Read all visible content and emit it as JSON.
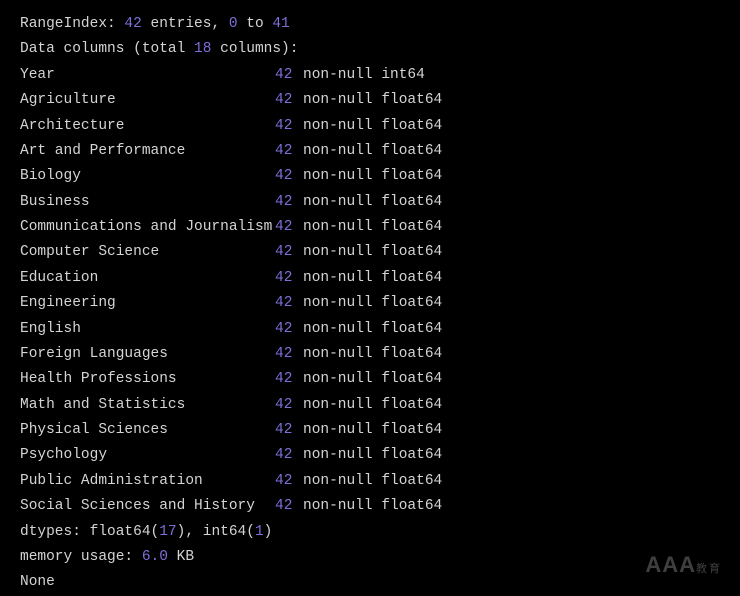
{
  "header": {
    "range_prefix": "RangeIndex: ",
    "entries_count": "42",
    "entries_text": " entries, ",
    "range_start": "0",
    "range_mid": " to ",
    "range_end": "41",
    "cols_prefix": "Data columns (total ",
    "cols_count": "18",
    "cols_suffix": " columns):"
  },
  "columns": [
    {
      "name": "Year",
      "count": "42",
      "suffix": "non-null int64"
    },
    {
      "name": "Agriculture",
      "count": "42",
      "suffix": "non-null float64"
    },
    {
      "name": "Architecture",
      "count": "42",
      "suffix": "non-null float64"
    },
    {
      "name": "Art and Performance",
      "count": "42",
      "suffix": "non-null float64"
    },
    {
      "name": "Biology",
      "count": "42",
      "suffix": "non-null float64"
    },
    {
      "name": "Business",
      "count": "42",
      "suffix": "non-null float64"
    },
    {
      "name": "Communications and Journalism",
      "count": "42",
      "suffix": "non-null float64"
    },
    {
      "name": "Computer Science",
      "count": "42",
      "suffix": "non-null float64"
    },
    {
      "name": "Education",
      "count": "42",
      "suffix": "non-null float64"
    },
    {
      "name": "Engineering",
      "count": "42",
      "suffix": "non-null float64"
    },
    {
      "name": "English",
      "count": "42",
      "suffix": "non-null float64"
    },
    {
      "name": "Foreign Languages",
      "count": "42",
      "suffix": "non-null float64"
    },
    {
      "name": "Health Professions",
      "count": "42",
      "suffix": "non-null float64"
    },
    {
      "name": "Math and Statistics",
      "count": "42",
      "suffix": "non-null float64"
    },
    {
      "name": "Physical Sciences",
      "count": "42",
      "suffix": "non-null float64"
    },
    {
      "name": "Psychology",
      "count": "42",
      "suffix": "non-null float64"
    },
    {
      "name": "Public Administration",
      "count": "42",
      "suffix": "non-null float64"
    },
    {
      "name": "Social Sciences and History",
      "count": "42",
      "suffix": "non-null float64"
    }
  ],
  "footer": {
    "dtypes_prefix": "dtypes: float64(",
    "float_count": "17",
    "dtypes_mid": "), int64(",
    "int_count": "1",
    "dtypes_suffix": ")",
    "mem_prefix": "memory usage: ",
    "mem_value": "6.0",
    "mem_suffix": " KB",
    "none": "None"
  },
  "watermark": {
    "main": "AAA",
    "sub": "教育"
  }
}
